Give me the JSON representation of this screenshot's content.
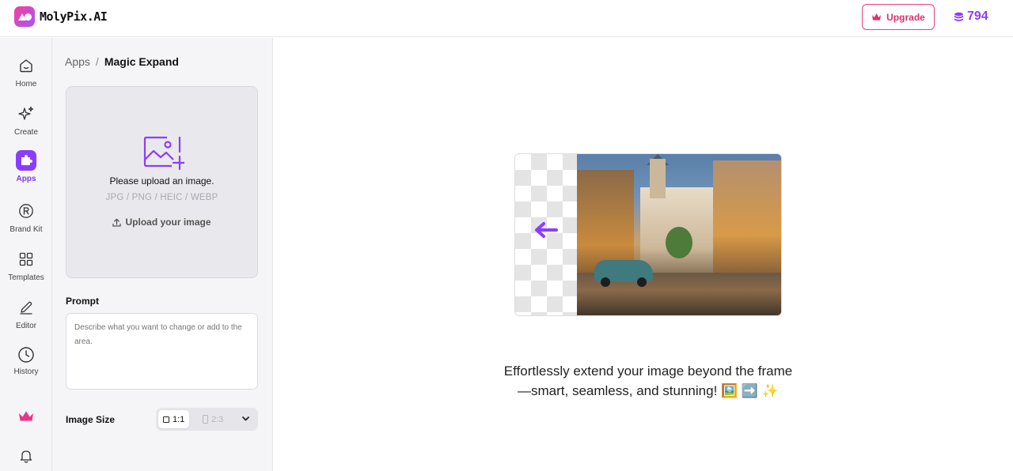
{
  "header": {
    "brand": "MolyPix.AI",
    "upgrade_label": "Upgrade",
    "credits": "794"
  },
  "rail": {
    "items": [
      {
        "label": "Home",
        "icon": "home-icon"
      },
      {
        "label": "Create",
        "icon": "sparkles-icon"
      },
      {
        "label": "Apps",
        "icon": "puzzle-icon",
        "active": true
      },
      {
        "label": "Brand Kit",
        "icon": "registered-icon"
      },
      {
        "label": "Templates",
        "icon": "grid-icon"
      },
      {
        "label": "Editor",
        "icon": "pencil-icon"
      },
      {
        "label": "History",
        "icon": "clock-icon"
      }
    ],
    "bottom": [
      "crown-icon",
      "bell-icon"
    ]
  },
  "breadcrumb": {
    "parent": "Apps",
    "separator": "/",
    "current": "Magic Expand"
  },
  "upload": {
    "title": "Please upload an image.",
    "formats": "JPG / PNG / HEIC / WEBP",
    "link_label": "Upload your image"
  },
  "prompt": {
    "label": "Prompt",
    "placeholder": "Describe what you want to change or add to the area."
  },
  "image_size": {
    "label": "Image Size",
    "selected": "1:1",
    "other": "2:3"
  },
  "main": {
    "caption": "Effortlessly extend your image beyond the frame—smart, seamless, and stunning! 🖼️ ➡️ ✨"
  },
  "colors": {
    "accent": "#8b3dff",
    "upgrade": "#e0306e",
    "rail_bg": "#f5f5f7"
  }
}
